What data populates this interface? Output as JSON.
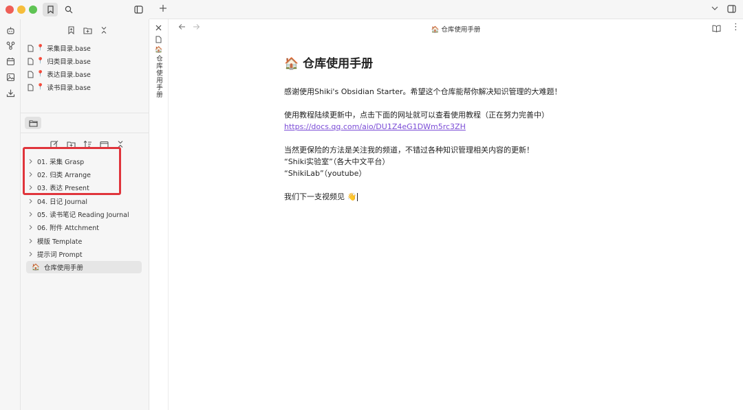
{
  "bookmarks": [
    {
      "label": "采集目录.base"
    },
    {
      "label": "归类目录.base"
    },
    {
      "label": "表达目录.base"
    },
    {
      "label": "读书目录.base"
    }
  ],
  "tree": [
    {
      "label": "01. 采集 Grasp"
    },
    {
      "label": "02. 归类 Arrange"
    },
    {
      "label": "03. 表达 Present"
    },
    {
      "label": "04. 日记 Journal"
    },
    {
      "label": "05. 读书笔记 Reading Journal"
    },
    {
      "label": "06. 附件 Attchment"
    },
    {
      "label": "模版 Template"
    },
    {
      "label": "提示词 Prompt"
    },
    {
      "label": "仓库使用手册",
      "emoji": "🏠"
    }
  ],
  "vtab": {
    "emoji": "🏠",
    "title": "仓库使用手册"
  },
  "view": {
    "title": "仓库使用手册",
    "emoji": "🏠"
  },
  "doc": {
    "heading": "仓库使用手册",
    "heading_emoji": "🏠",
    "p1": "感谢使用Shiki's Obsidian Starter。希望这个仓库能帮你解决知识管理的大难题！",
    "p2": "使用教程陆续更新中，点击下面的网址就可以查看使用教程（正在努力完善中）",
    "link": "https://docs.qq.com/aio/DU1Z4eG1DWm5rc3ZH",
    "p3": "当然更保险的方法是关注我的频道，不错过各种知识管理相关内容的更新！",
    "p4": "“Shiki实验室”（各大中文平台）",
    "p5": "“ShikiLab”（youtube）",
    "p6": "我们下一支视频见",
    "p6_emoji": "👋"
  },
  "colors": {
    "accent_link": "#7a4bd6",
    "highlight": "#e0343b"
  }
}
